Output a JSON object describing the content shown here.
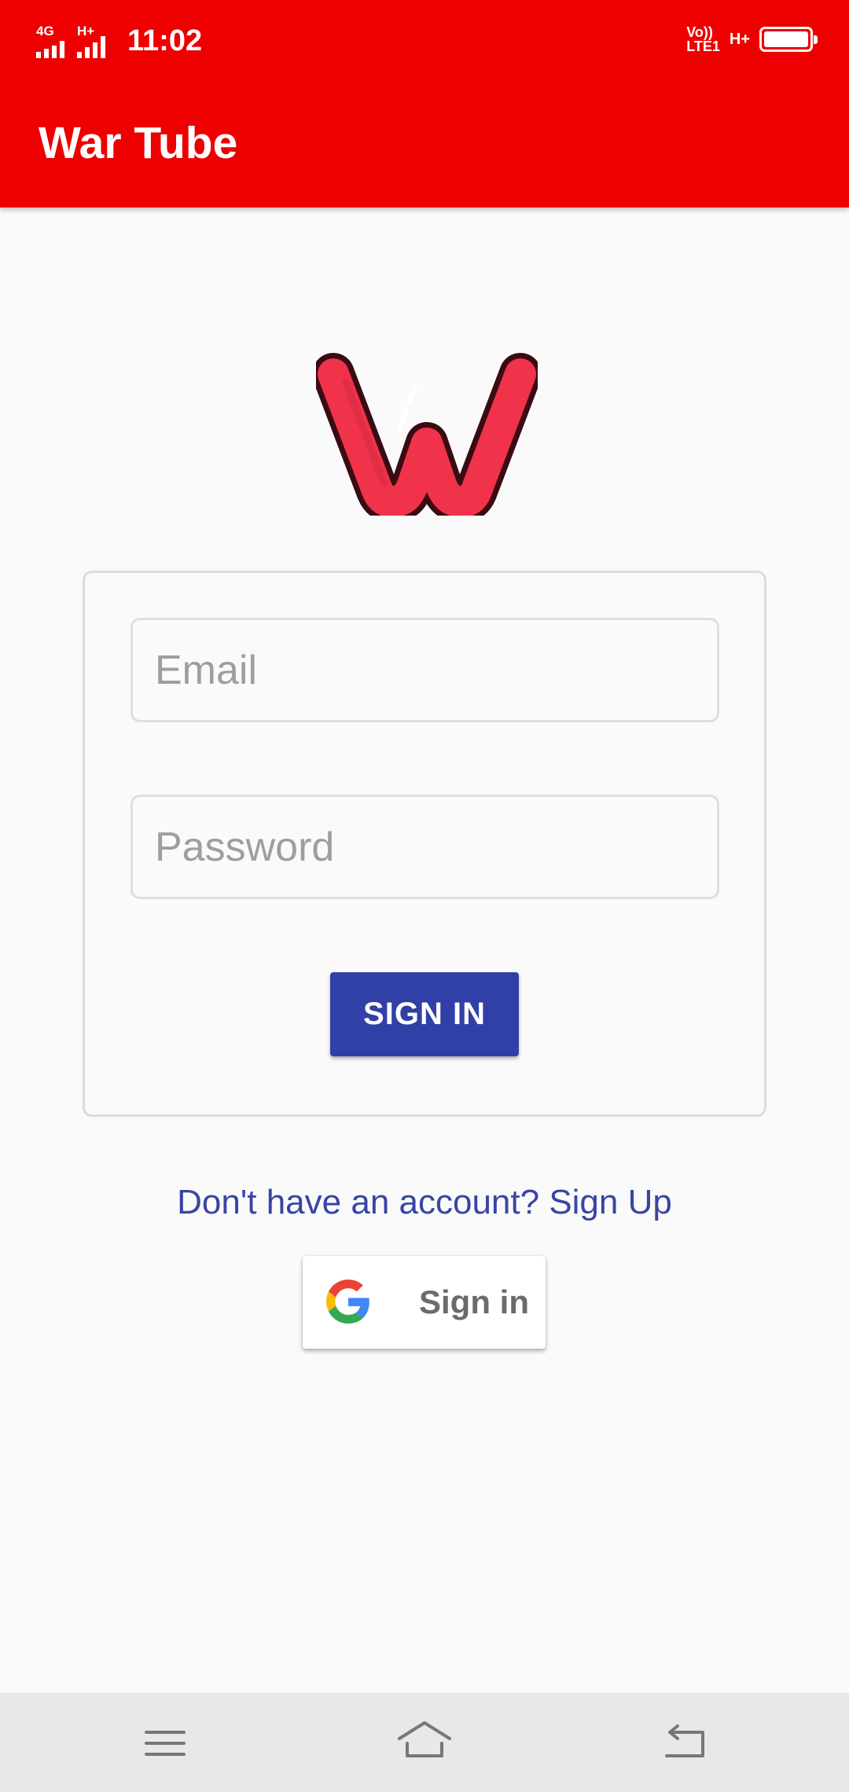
{
  "status_bar": {
    "time": "11:02",
    "network_1": "4G",
    "network_2": "H+",
    "volte_line1": "Vo))",
    "volte_line2": "LTE1",
    "data_type": "H+",
    "battery_level": 1.0
  },
  "app_bar": {
    "title": "War Tube"
  },
  "logo": {
    "icon": "war-tube-w-logo",
    "colors": {
      "fill": "#f0334a",
      "outline": "#3a0b12"
    }
  },
  "login_form": {
    "email_placeholder": "Email",
    "password_placeholder": "Password",
    "sign_in_label": "SIGN IN"
  },
  "signup_link": "Don't have an account? Sign Up",
  "google_button": {
    "label": "Sign in",
    "icon": "google-g-icon"
  },
  "nav_bar": {
    "items": [
      "menu-icon",
      "home-icon",
      "back-icon"
    ]
  },
  "colors": {
    "app_bar": "#ee0000",
    "primary_button": "#3140a6",
    "link": "#3845a5",
    "background": "#fafafa"
  }
}
